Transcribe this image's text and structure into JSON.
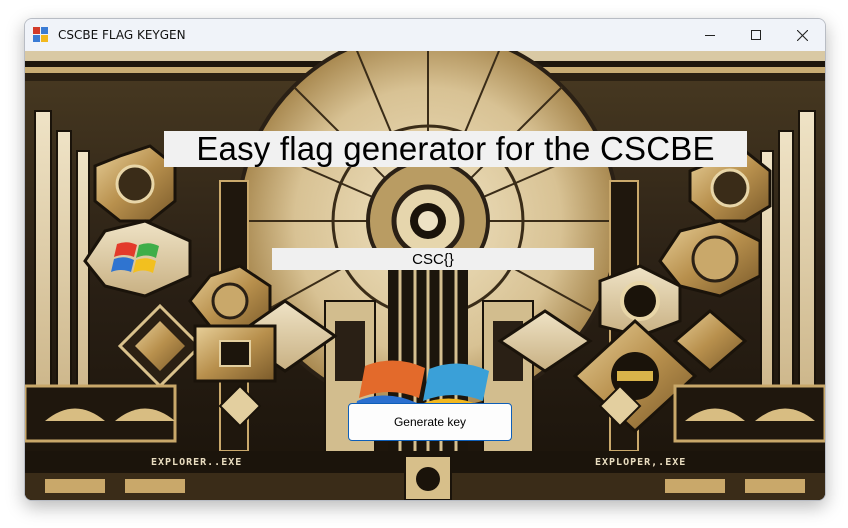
{
  "window": {
    "title": "CSCBE FLAG KEYGEN",
    "icon": "app-window-icon",
    "controls": [
      "minimize-icon",
      "maximize-icon",
      "close-icon"
    ]
  },
  "main": {
    "headline": "Easy flag generator for the CSCBE",
    "flag_value": "CSC{}",
    "button_label": "Generate key"
  },
  "background": {
    "left_label": "EXPLORER..EXE",
    "right_label": "EXPLOPER,.EXE"
  },
  "colors": {
    "gold": "#c9a86a",
    "dark": "#1c150c",
    "cream": "#e9dcbc",
    "accent_blue": "#0f5fb8"
  }
}
